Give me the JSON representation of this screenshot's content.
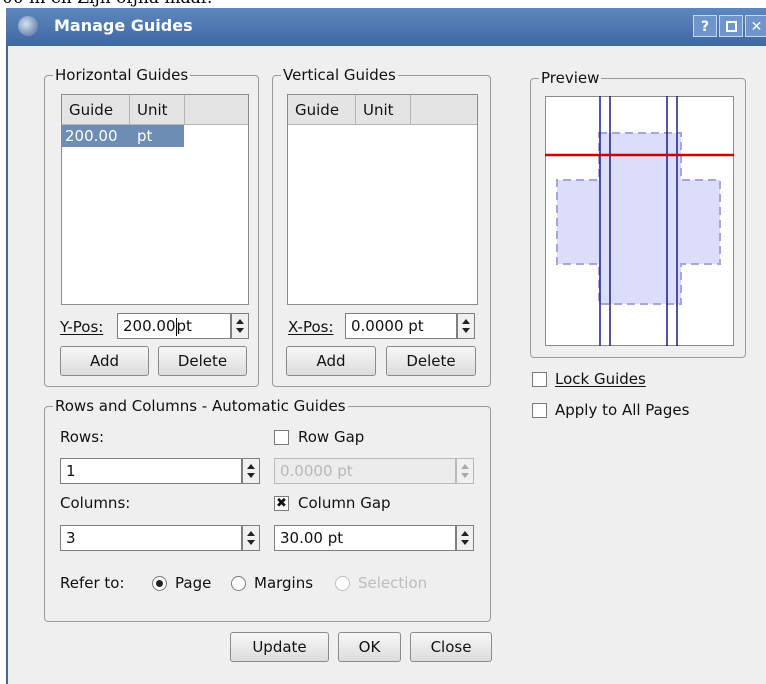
{
  "cropped_top_text": "00 in en Zijn ofjna maar.",
  "window": {
    "title": "Manage Guides",
    "help_label": "?",
    "maximize_label": "□",
    "close_label": "✕"
  },
  "horizontal": {
    "legend": "Horizontal Guides",
    "col_guide": "Guide",
    "col_unit": "Unit",
    "rows": [
      {
        "guide": "200.00",
        "unit": "pt"
      }
    ],
    "pos_label": "Y-Pos:",
    "pos_value": "200.00",
    "pos_unit": "pt",
    "add_label": "Add",
    "delete_label": "Delete"
  },
  "vertical": {
    "legend": "Vertical Guides",
    "col_guide": "Guide",
    "col_unit": "Unit",
    "rows": [],
    "pos_label": "X-Pos:",
    "pos_value": "0.0000 pt",
    "add_label": "Add",
    "delete_label": "Delete"
  },
  "preview": {
    "legend": "Preview"
  },
  "options": {
    "lock_label": "Lock Guides",
    "lock_checked": false,
    "apply_label": "Apply to All Pages",
    "apply_checked": false
  },
  "auto": {
    "legend": "Rows and Columns - Automatic Guides",
    "rows_label": "Rows:",
    "rows_value": "1",
    "row_gap_label": "Row Gap",
    "row_gap_checked": false,
    "row_gap_value": "0.0000 pt",
    "columns_label": "Columns:",
    "columns_value": "3",
    "column_gap_label": "Column Gap",
    "column_gap_checked": true,
    "column_gap_value": "30.00 pt",
    "refer_label": "Refer to:",
    "refer_options": [
      {
        "label": "Page",
        "selected": true,
        "enabled": true
      },
      {
        "label": "Margins",
        "selected": false,
        "enabled": true
      },
      {
        "label": "Selection",
        "selected": false,
        "enabled": false
      }
    ]
  },
  "footer": {
    "update_label": "Update",
    "ok_label": "OK",
    "close_label": "Close"
  },
  "colors": {
    "title_bar": "#4a74ae",
    "selection": "#6d8db5",
    "guide_red": "#cc0000",
    "guide_blue": "#1a1a8c",
    "page_fill": "#dcdcfb"
  }
}
